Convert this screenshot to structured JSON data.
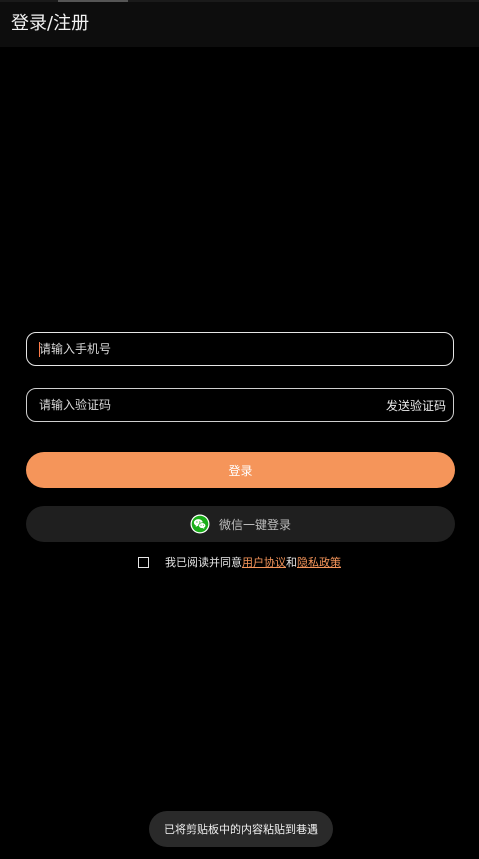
{
  "header": {
    "title": "登录/注册"
  },
  "phone_field": {
    "placeholder": "请输入手机号",
    "value": ""
  },
  "code_field": {
    "placeholder": "请输入验证码",
    "value": "",
    "send_code_label": "发送验证码"
  },
  "login_button": {
    "label": "登录"
  },
  "wechat_login": {
    "icon": "wechat-icon",
    "label": "微信一键登录"
  },
  "agreement": {
    "checked": false,
    "prefix": "我已阅读并同意",
    "user_agreement": " 用户协议 ",
    "conjunction": "和",
    "privacy_policy": " 隐私政策"
  },
  "toast": {
    "message": "已将剪贴板中的内容粘贴到巷遇"
  },
  "colors": {
    "accent": "#f5955a",
    "background": "#000000",
    "wechat_green": "#1aad19"
  }
}
